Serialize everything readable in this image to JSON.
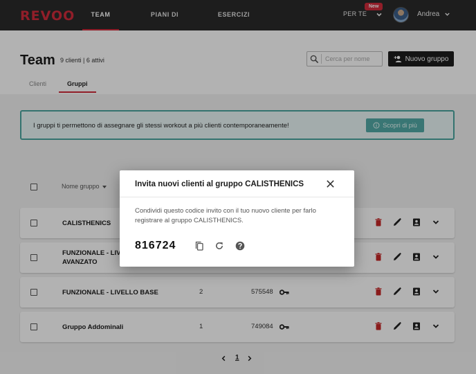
{
  "nav": {
    "logo": "REVOO",
    "tabs": [
      {
        "label": "TEAM"
      },
      {
        "label": "PIANI DI ALLENAMENTO"
      },
      {
        "label": "ESERCIZI"
      }
    ],
    "per_te_label": "PER TE",
    "new_badge": "New",
    "user_name": "Andrea"
  },
  "page": {
    "title": "Team",
    "subtitle": "9 clienti | 6 attivi",
    "search_placeholder": "Cerca per nome",
    "new_group_button": "Nuovo gruppo",
    "subtabs": [
      {
        "label": "Clienti"
      },
      {
        "label": "Gruppi"
      }
    ]
  },
  "banner": {
    "text": "I gruppi ti permettono di assegnare gli stessi workout a più clienti contemporaneamente!",
    "button": "Scopri di più"
  },
  "table": {
    "header_name": "Nome gruppo",
    "rows": [
      {
        "name": "CALISTHENICS",
        "count": "",
        "code": ""
      },
      {
        "name": "FUNZIONALE - LIVELLO AVANZATO",
        "count": "",
        "code": ""
      },
      {
        "name": "FUNZIONALE - LIVELLO BASE",
        "count": "2",
        "code": "575548"
      },
      {
        "name": "Gruppo Addominali",
        "count": "1",
        "code": "749084"
      }
    ]
  },
  "pagination": {
    "current_page": "1"
  },
  "modal": {
    "title": "Invita nuovi clienti al gruppo CALISTHENICS",
    "description": "Condividi questo codice invito con il tuo nuovo cliente per farlo registrare al gruppo CALISTHENICS.",
    "code": "816724"
  },
  "colors": {
    "brand_red": "#d02b3c",
    "teal": "#4aa5a0",
    "topbar": "#2a2a2a"
  }
}
